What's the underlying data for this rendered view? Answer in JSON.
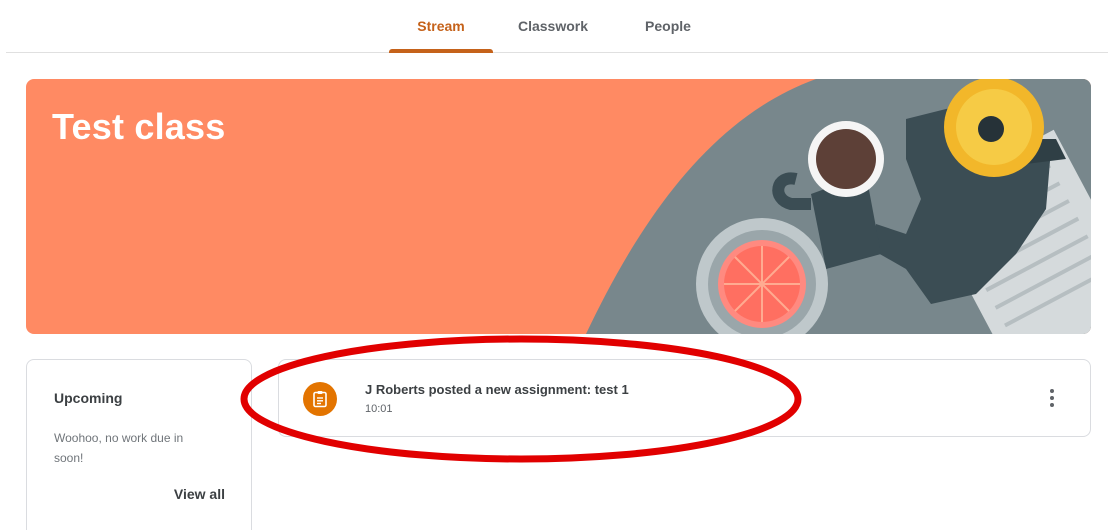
{
  "tabs": [
    {
      "label": "Stream",
      "active": true
    },
    {
      "label": "Classwork",
      "active": false
    },
    {
      "label": "People",
      "active": false
    }
  ],
  "banner": {
    "title": "Test class",
    "accent_color": "#ff8a63"
  },
  "upcoming": {
    "title": "Upcoming",
    "message": "Woohoo, no work due in soon!",
    "view_all_label": "View all"
  },
  "stream": {
    "posts": [
      {
        "text": "J Roberts posted a new assignment: test 1",
        "time": "10:01",
        "icon": "assignment-icon"
      }
    ]
  },
  "colors": {
    "active_tab": "#c5621a",
    "assignment_icon_bg": "#e37400",
    "annotation": "#e10000"
  }
}
